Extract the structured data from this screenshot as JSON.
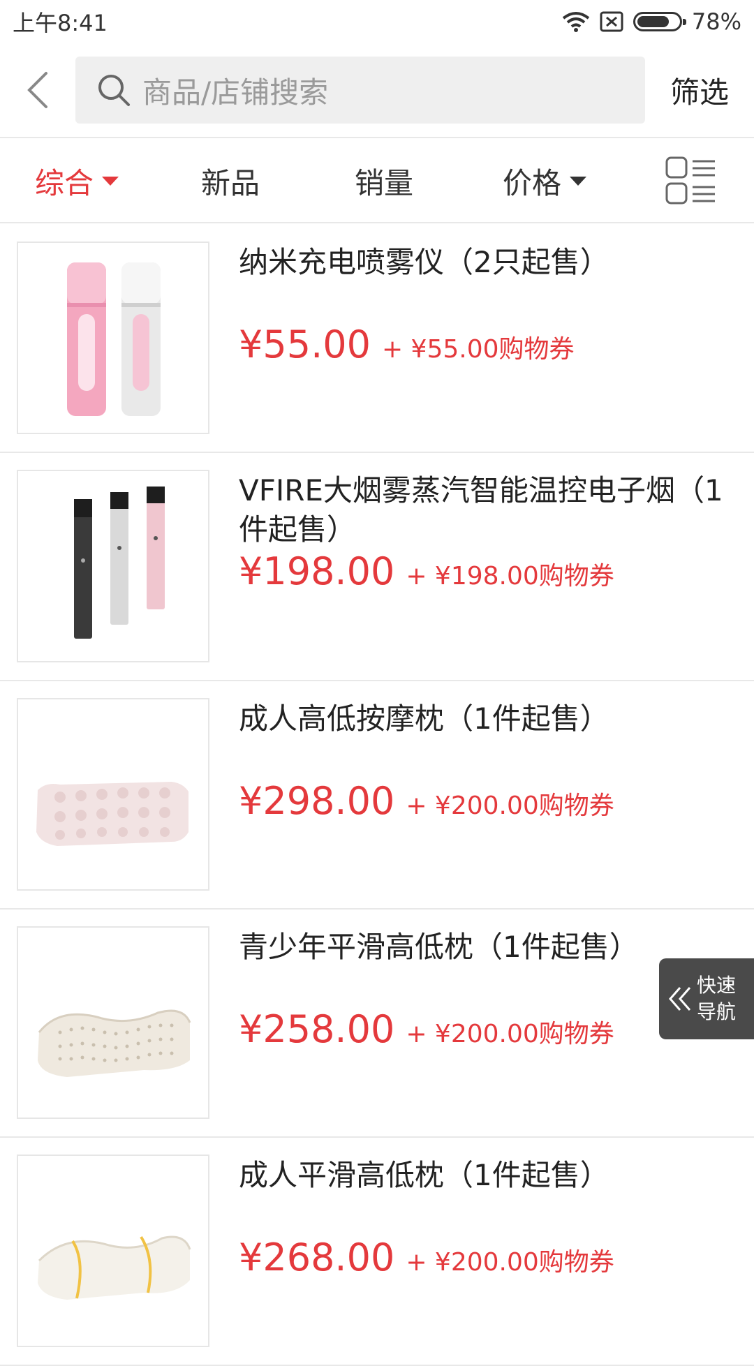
{
  "status": {
    "time": "上午8:41",
    "battery_text": "78%",
    "battery_level": 0.78
  },
  "header": {
    "search_placeholder": "商品/店铺搜索",
    "filter_label": "筛选"
  },
  "sort": {
    "items": [
      {
        "label": "综合",
        "active": true
      },
      {
        "label": "新品"
      },
      {
        "label": "销量"
      },
      {
        "label": "价格"
      }
    ]
  },
  "products": [
    {
      "name": "纳米充电喷雾仪（2只起售）",
      "price": "¥55.00",
      "coupon": "+ ¥55.00购物券"
    },
    {
      "name": "VFIRE大烟雾蒸汽智能温控电子烟（1件起售）",
      "price": "¥198.00",
      "coupon": "+ ¥198.00购物券"
    },
    {
      "name": "成人高低按摩枕（1件起售）",
      "price": "¥298.00",
      "coupon": "+ ¥200.00购物券"
    },
    {
      "name": "青少年平滑高低枕（1件起售）",
      "price": "¥258.00",
      "coupon": "+ ¥200.00购物券"
    },
    {
      "name": "成人平滑高低枕（1件起售）",
      "price": "¥268.00",
      "coupon": "+ ¥200.00购物券"
    }
  ],
  "quick_nav": {
    "line1": "快速",
    "line2": "导航"
  },
  "colors": {
    "accent": "#e4393c",
    "divider": "#e8e8e8"
  }
}
